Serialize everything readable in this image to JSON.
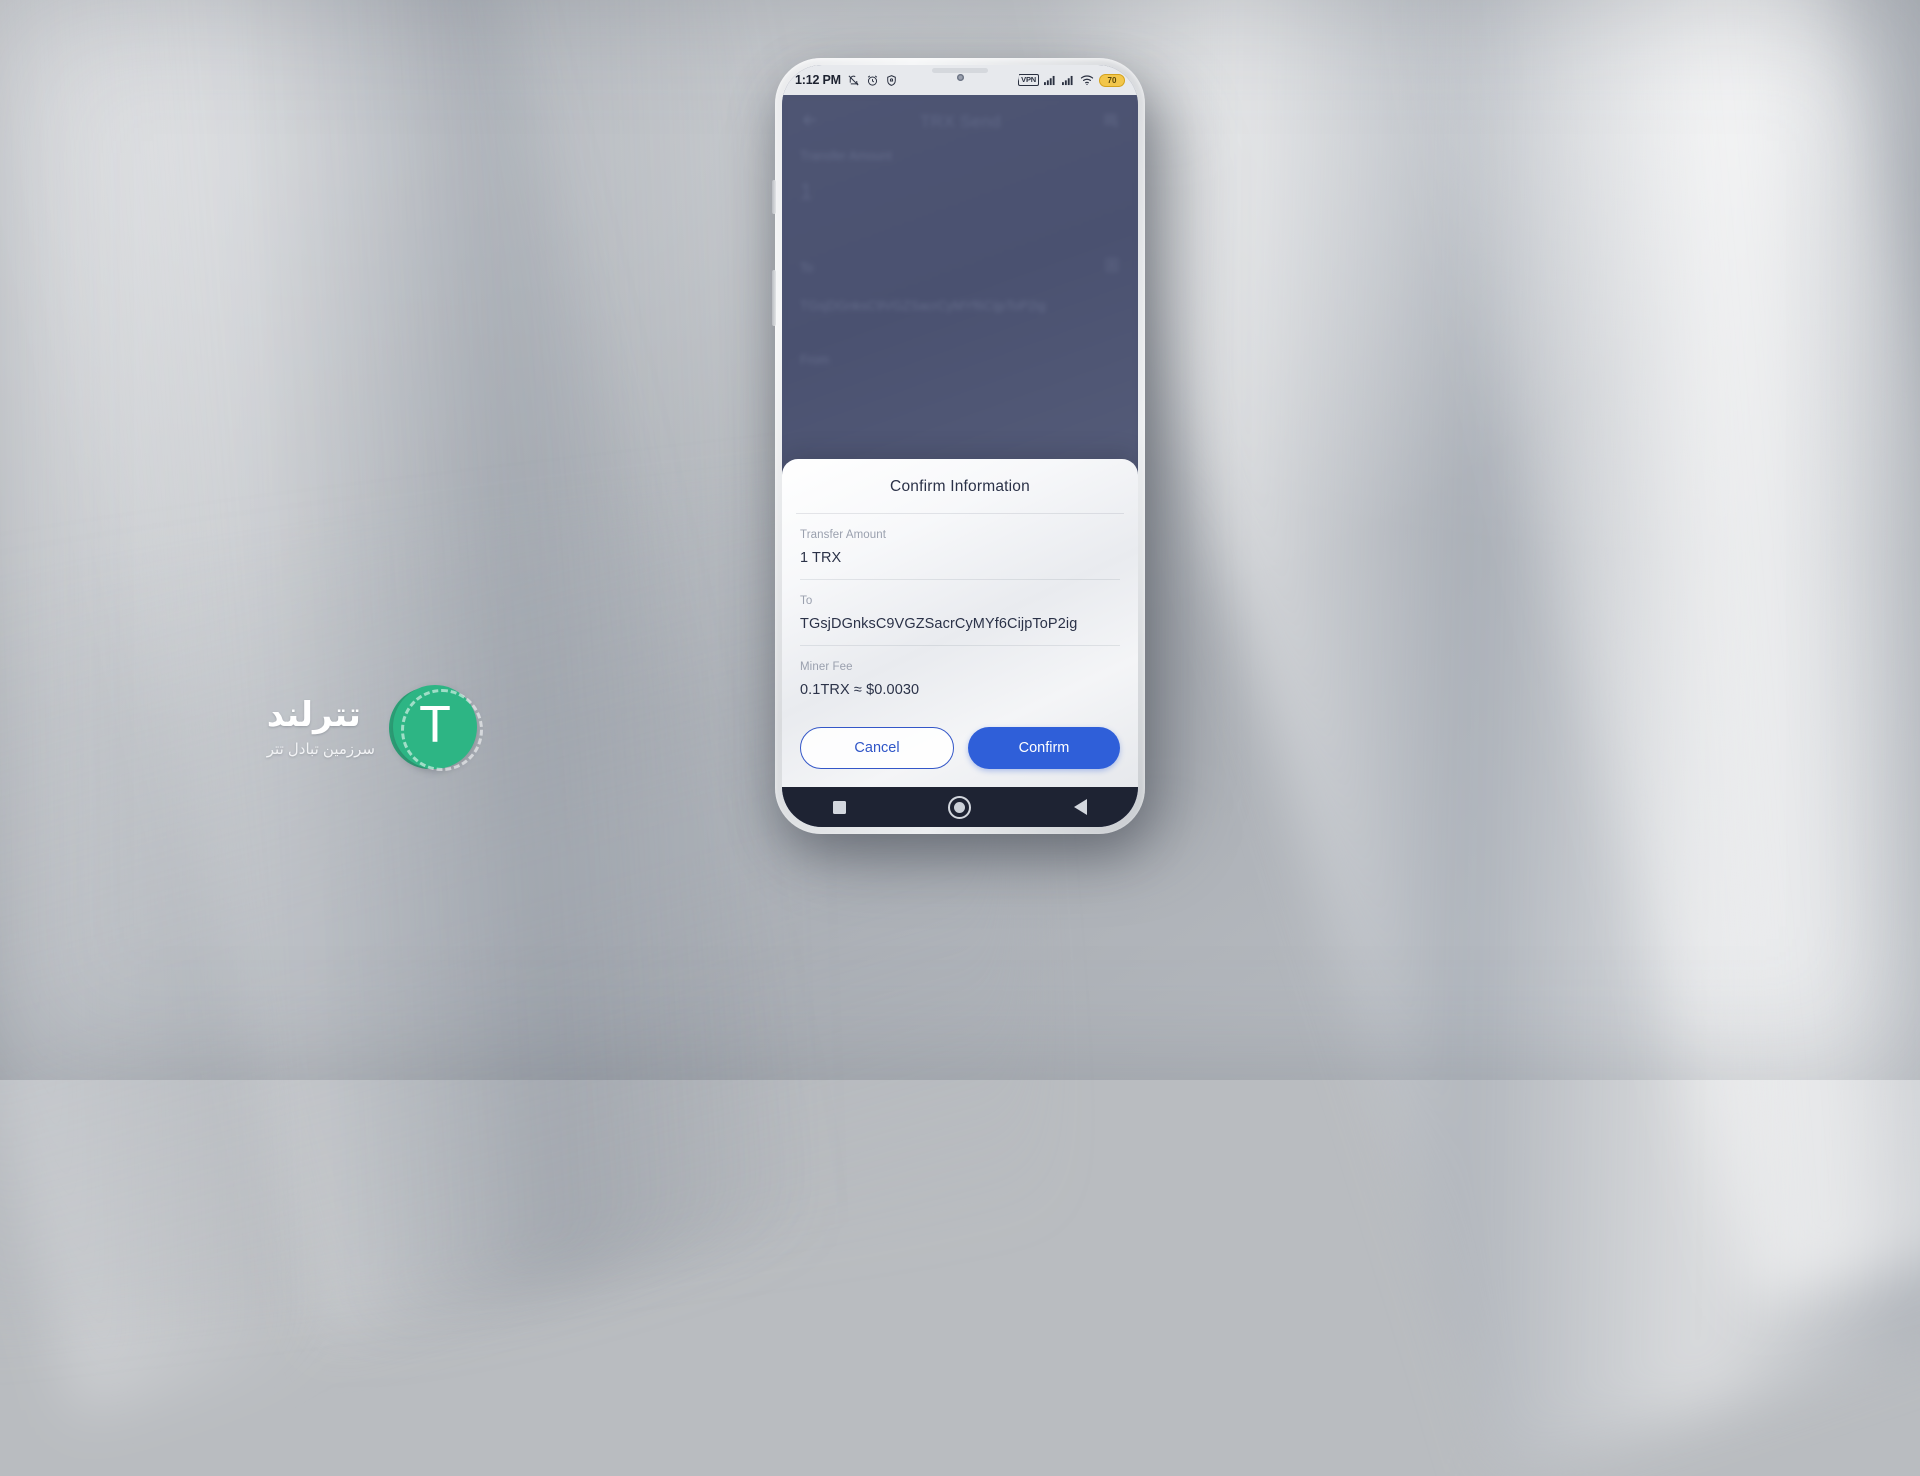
{
  "brand": {
    "title": "تترلند",
    "subtitle": "سرزمین تبادل تتر",
    "logo_letter": "T",
    "logo_color": "#2db584"
  },
  "phone": {
    "status_bar": {
      "clock": "1:12 PM",
      "left_icons": [
        "mute-icon",
        "alarm-icon",
        "security-shield-icon"
      ],
      "vpn_label": "VPN",
      "right_icons": [
        "vpn-badge",
        "signal-sim1-icon",
        "signal-sim2-icon",
        "wifi-icon"
      ],
      "battery_level": "70"
    },
    "app_background": {
      "back_icon": "back-arrow-icon",
      "title": "TRX Send",
      "records_icon": "transaction-records-icon",
      "amount_label": "Transfer Amount",
      "amount_value": "1",
      "to_label": "To",
      "to_value": "TGsjDGnksC9VGZSacrCyMYf6CijpToP2ig",
      "scan_icon": "address-book-icon",
      "from_label": "From"
    },
    "dialog": {
      "title": "Confirm Information",
      "fields": [
        {
          "label": "Transfer Amount",
          "value": "1 TRX"
        },
        {
          "label": "To",
          "value": "TGsjDGnksC9VGZSacrCyMYf6CijpToP2ig"
        },
        {
          "label": "Miner Fee",
          "value": "0.1TRX ≈ $0.0030"
        }
      ],
      "cancel_label": "Cancel",
      "confirm_label": "Confirm",
      "confirm_color": "#2f5fd9",
      "cancel_border_color": "#3457c8"
    },
    "nav_bar": {
      "recents_icon": "recents-square-icon",
      "home_icon": "home-circle-icon",
      "back_icon": "back-triangle-icon"
    }
  }
}
